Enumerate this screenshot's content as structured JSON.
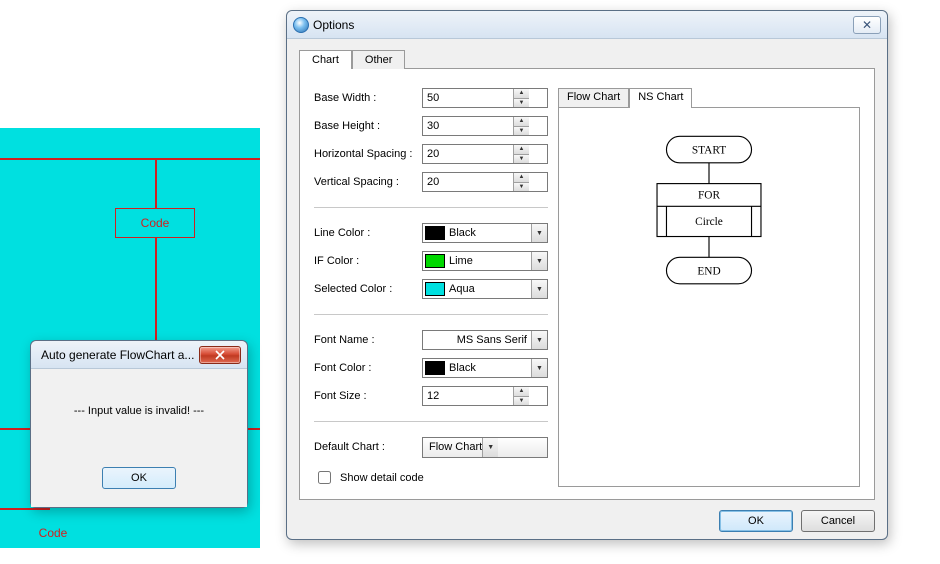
{
  "canvas": {
    "node_label": "Code",
    "node2_label": "Code"
  },
  "alert": {
    "title": "Auto generate FlowChart a...",
    "message": "---   Input value is invalid!   ---",
    "ok": "OK"
  },
  "options": {
    "title": "Options",
    "tabs": {
      "chart": "Chart",
      "other": "Other"
    },
    "fields": {
      "base_width_label": "Base Width :",
      "base_width": "50",
      "base_height_label": "Base Height :",
      "base_height": "30",
      "hspacing_label": "Horizontal Spacing :",
      "hspacing": "20",
      "vspacing_label": "Vertical Spacing :",
      "vspacing": "20",
      "line_color_label": "Line Color :",
      "line_color_name": "Black",
      "line_color_hex": "#000000",
      "if_color_label": "IF Color :",
      "if_color_name": "Lime",
      "if_color_hex": "#00d800",
      "sel_color_label": "Selected Color :",
      "sel_color_name": "Aqua",
      "sel_color_hex": "#00e0e0",
      "font_name_label": "Font Name :",
      "font_name": "MS Sans Serif",
      "font_color_label": "Font Color :",
      "font_color_name": "Black",
      "font_color_hex": "#000000",
      "font_size_label": "Font Size :",
      "font_size": "12",
      "default_chart_label": "Default Chart :",
      "default_chart": "Flow Chart",
      "show_detail_label": "Show detail code",
      "show_detail_checked": false
    },
    "preview_tabs": {
      "flow": "Flow Chart",
      "ns": "NS Chart"
    },
    "preview": {
      "start": "START",
      "for": "FOR",
      "circle": "Circle",
      "end": "END"
    },
    "buttons": {
      "ok": "OK",
      "cancel": "Cancel"
    }
  }
}
